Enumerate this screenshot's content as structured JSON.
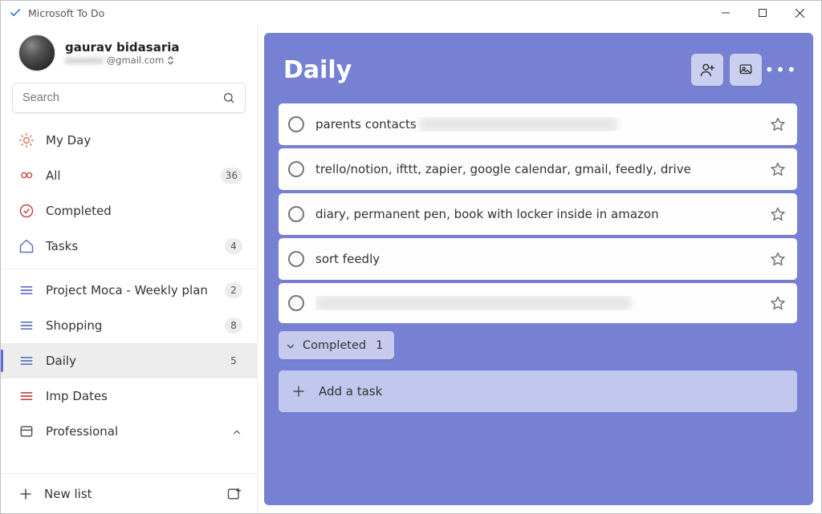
{
  "app_title": "Microsoft To Do",
  "user": {
    "name": "gaurav bidasaria",
    "email_hidden_prefix": "xxxxxxx",
    "email_visible_suffix": "@gmail.com"
  },
  "search": {
    "placeholder": "Search"
  },
  "smart_lists": [
    {
      "id": "myday",
      "label": "My Day",
      "icon": "sun",
      "count": null
    },
    {
      "id": "all",
      "label": "All",
      "icon": "infinity",
      "count": "36"
    },
    {
      "id": "completed",
      "label": "Completed",
      "icon": "check-circ",
      "count": null
    },
    {
      "id": "tasks",
      "label": "Tasks",
      "icon": "home",
      "count": "4"
    }
  ],
  "user_lists": [
    {
      "id": "moca",
      "label": "Project Moca - Weekly plan",
      "icon_color": "blue",
      "count": "2",
      "active": false
    },
    {
      "id": "shop",
      "label": "Shopping",
      "icon_color": "blue",
      "count": "8",
      "active": false
    },
    {
      "id": "daily",
      "label": "Daily",
      "icon_color": "blue",
      "count": "5",
      "active": true
    },
    {
      "id": "imp",
      "label": "Imp Dates",
      "icon_color": "red",
      "count": null,
      "active": false
    },
    {
      "id": "prof",
      "label": "Professional",
      "icon_color": "group",
      "count": null,
      "active": false,
      "expandable": true
    }
  ],
  "new_list_label": "New list",
  "list_view": {
    "title": "Daily",
    "tasks": [
      {
        "text_pre": "parents contacts ",
        "text_blur": "xxxxxxx xxxxxxx xxxxxx xxxxxx",
        "text_post": ""
      },
      {
        "text_pre": "trello/notion, ifttt, zapier, google calendar, gmail, feedly, drive",
        "text_blur": "",
        "text_post": ""
      },
      {
        "text_pre": "diary, permanent pen, book  with locker inside in amazon",
        "text_blur": "",
        "text_post": ""
      },
      {
        "text_pre": "sort feedly",
        "text_blur": "",
        "text_post": ""
      },
      {
        "text_pre": "",
        "text_blur": "xxxxxxxx xxxxxx xxxxxxx xxxxx xxxx xxx xxxxxxxx",
        "text_post": ""
      }
    ],
    "completed_label": "Completed",
    "completed_count": "1",
    "add_task_label": "Add a task"
  }
}
